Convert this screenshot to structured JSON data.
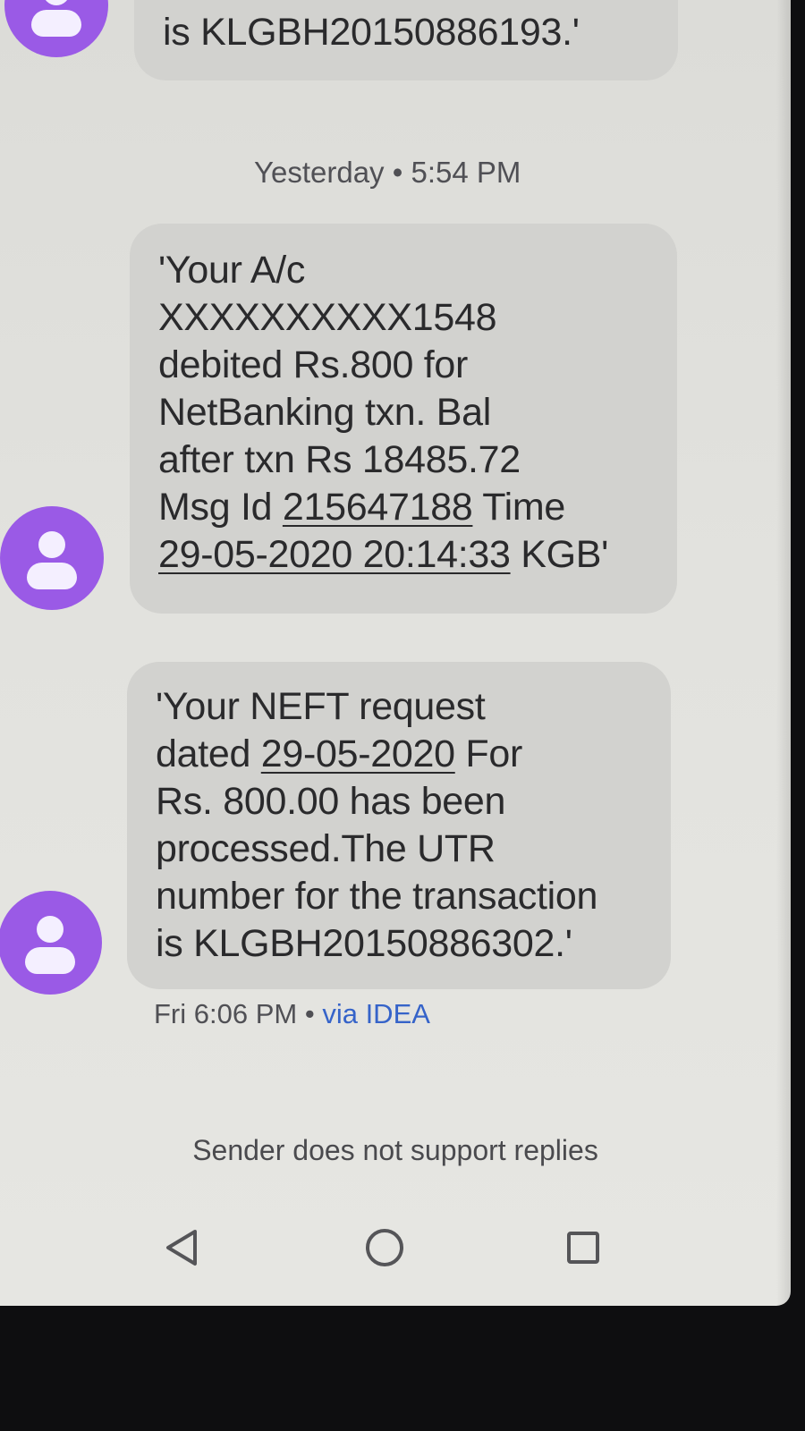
{
  "messages": [
    {
      "lines_tail": "is KLGBH20150886193.'"
    },
    {
      "time_day": "Yesterday",
      "time_sep": "•",
      "time_clock": "5:54 PM",
      "line1": "'Your A/c",
      "line2": "XXXXXXXXXX1548",
      "line3": "debited Rs.800 for",
      "line4": "NetBanking txn. Bal",
      "line5": "after txn Rs 18485.72",
      "line6_pre": "Msg Id ",
      "msg_id": "215647188",
      "line6_post": " Time",
      "datetime": "29-05-2020 20:14:33",
      "line7_post": " KGB'"
    },
    {
      "line1": "'Your NEFT request",
      "line2_pre": "dated ",
      "date": "29-05-2020",
      "line2_post": " For",
      "line3": "Rs. 800.00 has been",
      "line4": "processed.The UTR",
      "line5": "number for the transaction",
      "line6": "is KLGBH20150886302.'",
      "footer_time": "Fri 6:06 PM",
      "footer_sep": "•",
      "footer_via": "via IDEA"
    }
  ],
  "reply_note": "Sender does not support replies",
  "icons": {
    "avatar": "person-icon",
    "back": "back-triangle-icon",
    "home": "home-circle-icon",
    "recents": "recents-square-icon"
  },
  "colors": {
    "avatar": "#9a5ae6",
    "bubble": "#d2d2cf",
    "via_link": "#3563c9"
  }
}
